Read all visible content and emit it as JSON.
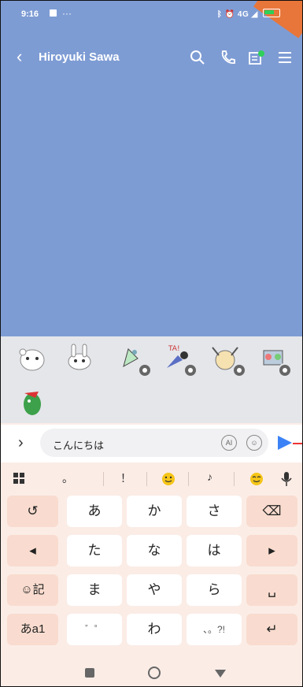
{
  "status": {
    "time": "9:16",
    "indicators": "ᛒ ⏰ 4G"
  },
  "header": {
    "back_icon": "‹",
    "title": "Hiroyuki Sawa"
  },
  "input": {
    "text": "こんにちは",
    "ai_label": "AI"
  },
  "toolbar": {
    "items": [
      "。",
      "！",
      "♪"
    ]
  },
  "keyboard": {
    "row1": [
      "あ",
      "か",
      "さ"
    ],
    "row2": [
      "た",
      "な",
      "は"
    ],
    "row3": [
      "ま",
      "や",
      "ら"
    ],
    "row4": [
      "わ"
    ],
    "undo": "↺",
    "left": "◂",
    "right": "▸",
    "emoji_label": "☺記",
    "mode_label": "あa1",
    "dakuten": "゛゜",
    "punct": "、。?!",
    "backspace": "⌫",
    "space": "␣",
    "enter": "↵"
  }
}
